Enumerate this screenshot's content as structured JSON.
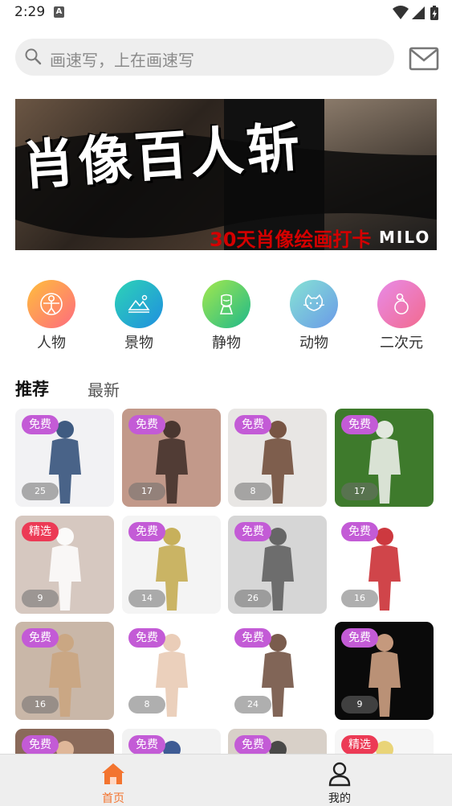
{
  "status_bar": {
    "time": "2:29",
    "notif_glyph": "A"
  },
  "search": {
    "placeholder": "画速写，上在画速写"
  },
  "banner": {
    "title": "肖像百人斩",
    "subtitle": "30天肖像绘画打卡",
    "brand": "MILO"
  },
  "categories": [
    {
      "label": "人物",
      "icon": "person-figure-icon",
      "colors": [
        "#fd6b7f",
        "#ffbe3c"
      ]
    },
    {
      "label": "景物",
      "icon": "landscape-icon",
      "colors": [
        "#2dd3b6",
        "#1f8fe0"
      ]
    },
    {
      "label": "静物",
      "icon": "still-life-icon",
      "colors": [
        "#a3e84d",
        "#1fb98a"
      ]
    },
    {
      "label": "动物",
      "icon": "cat-icon",
      "colors": [
        "#86e3d4",
        "#6a9ae8"
      ]
    },
    {
      "label": "二次元",
      "icon": "anime-icon",
      "colors": [
        "#e88be8",
        "#f26a8e"
      ]
    }
  ],
  "tabs": {
    "recommended": "推荐",
    "latest": "最新"
  },
  "cards": [
    {
      "badge": "免费",
      "type": "free",
      "count": "25",
      "bg": "#f2f2f4",
      "fig": "#2b4a74"
    },
    {
      "badge": "免费",
      "type": "free",
      "count": "17",
      "bg": "#c2998a",
      "fig": "#3d2c26"
    },
    {
      "badge": "免费",
      "type": "free",
      "count": "8",
      "bg": "#e8e6e4",
      "fig": "#6b4532"
    },
    {
      "badge": "免费",
      "type": "free",
      "count": "17",
      "bg": "#3e7a2c",
      "fig": "#f4f4f2"
    },
    {
      "badge": "精选",
      "type": "pick",
      "count": "9",
      "bg": "#d6c8c0",
      "fig": "#ffffff"
    },
    {
      "badge": "免费",
      "type": "free",
      "count": "14",
      "bg": "#f4f4f4",
      "fig": "#c2a84a"
    },
    {
      "badge": "免费",
      "type": "free",
      "count": "26",
      "bg": "#d6d6d6",
      "fig": "#5a5a5a"
    },
    {
      "badge": "免费",
      "type": "free",
      "count": "16",
      "bg": "#ffffff",
      "fig": "#c8242a"
    },
    {
      "badge": "免费",
      "type": "free",
      "count": "16",
      "bg": "#c9b7a8",
      "fig": "#caa57e"
    },
    {
      "badge": "免费",
      "type": "free",
      "count": "8",
      "bg": "#ffffff",
      "fig": "#e8c8b0"
    },
    {
      "badge": "免费",
      "type": "free",
      "count": "24",
      "bg": "#ffffff",
      "fig": "#6b4a3a"
    },
    {
      "badge": "免费",
      "type": "free",
      "count": "9",
      "bg": "#0a0a0a",
      "fig": "#d9a98a"
    },
    {
      "badge": "免费",
      "type": "free",
      "count": "",
      "bg": "#8a6a5a",
      "fig": "#e8c0a0"
    },
    {
      "badge": "免费",
      "type": "free",
      "count": "",
      "bg": "#f2f2f2",
      "fig": "#2a4a8a"
    },
    {
      "badge": "免费",
      "type": "free",
      "count": "",
      "bg": "#d8d0c8",
      "fig": "#3a3a3a"
    },
    {
      "badge": "精选",
      "type": "pick",
      "count": "",
      "bg": "#f6f6f6",
      "fig": "#e8d06a"
    }
  ],
  "bottom_nav": {
    "home_label": "首页",
    "mine_label": "我的",
    "active_color": "#f3742f"
  }
}
